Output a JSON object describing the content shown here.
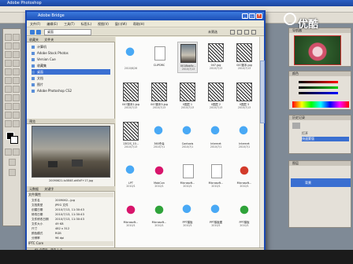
{
  "photoshop": {
    "title": "Adobe Photoshop",
    "menu": [],
    "watermark": "优酷"
  },
  "bridge": {
    "title": "Adobe Bridge",
    "menu": [
      "文件(F)",
      "编辑(E)",
      "工具(T)",
      "标签(L)",
      "视图(V)",
      "窗口(W)",
      "帮助(H)"
    ],
    "path_label": "桌面",
    "view_label": "未筛选",
    "left_tabs": [
      "收藏夹",
      "文件夹"
    ],
    "favorites": [
      "计算机",
      "Adobe Stock Photos",
      "Version Cue",
      "收藏集",
      "桌面",
      "文档",
      "图片",
      "Adobe Photoshop CS2"
    ],
    "preview_tab": "预览",
    "preview_caption": "20090621-tu584E-ahEdF+17.jpg",
    "metadata_tabs": [
      "元数据",
      "关键字"
    ],
    "metadata_section": "文件属性",
    "metadata": [
      {
        "k": "文件名",
        "v": "2009062...jpg"
      },
      {
        "k": "文档类型",
        "v": "JPEG 文件"
      },
      {
        "k": "创建日期",
        "v": "2010/7/13, 11:30:43"
      },
      {
        "k": "修改日期",
        "v": "2010/7/13, 11:30:43"
      },
      {
        "k": "文件修改日期",
        "v": "2010/7/13, 11:30:43"
      },
      {
        "k": "文件大小",
        "v": "49 KB"
      },
      {
        "k": "尺寸",
        "v": "482 x 312"
      },
      {
        "k": "颜色模式",
        "v": "RGB"
      },
      {
        "k": "分辨率",
        "v": "96 dpi"
      },
      {
        "k": "位深度",
        "v": "8"
      }
    ],
    "iptc_section": "IPTC Core",
    "status": "65 个项目，选中 1 个",
    "thumbnails": [
      {
        "label": "",
        "date": "2010/6/26",
        "kind": "ie"
      },
      {
        "label": "CLIPDRC",
        "date": "",
        "kind": "doc"
      },
      {
        "label": "0018bb5c...",
        "date": "2010/7/13",
        "kind": "photo"
      },
      {
        "label": "047.jpg",
        "date": "2010/7/13",
        "kind": "sketch"
      },
      {
        "label": "047副本.jpg",
        "date": "2010/7/13",
        "kind": "sketch"
      },
      {
        "label": "047副本2.jpg",
        "date": "2010/7/13",
        "kind": "sketch"
      },
      {
        "label": "047副本3.jpg",
        "date": "2010/7/13",
        "kind": "sketch"
      },
      {
        "label": "0图层 1",
        "date": "2010/7/13",
        "kind": "sketch"
      },
      {
        "label": "0图层 2",
        "date": "2010/7/13",
        "kind": "sketch"
      },
      {
        "label": "0图层 3",
        "date": "2010/7/13",
        "kind": "sketch"
      },
      {
        "label": "1302S_10...",
        "date": "2010/7/13",
        "kind": "sketch"
      },
      {
        "label": "360杀毒",
        "date": "2010/7/1",
        "kind": "ie"
      },
      {
        "label": "Contoxis",
        "date": "2010/7/1",
        "kind": "ie"
      },
      {
        "label": "Internet",
        "date": "2010/7/1",
        "kind": "ie"
      },
      {
        "label": "Internet",
        "date": "2010/7/1",
        "kind": "ie"
      },
      {
        "label": "LPT",
        "date": "2010/1",
        "kind": "ie"
      },
      {
        "label": "MobCon",
        "date": "2010/1",
        "kind": "magenta"
      },
      {
        "label": "Microsoft...",
        "date": "2010/1",
        "kind": "doc"
      },
      {
        "label": "Microsoft...",
        "date": "2010/1",
        "kind": "doc"
      },
      {
        "label": "Microsoft...",
        "date": "2010/1",
        "kind": "red"
      },
      {
        "label": "Microsoft...",
        "date": "2010/1",
        "kind": "magenta"
      },
      {
        "label": "Microsoft...",
        "date": "2010/1",
        "kind": "green"
      },
      {
        "label": "PPT模板",
        "date": "2010/1",
        "kind": "ie"
      },
      {
        "label": "PPT模板图",
        "date": "2010/1",
        "kind": "ie"
      },
      {
        "label": "PPT模板",
        "date": "2010/1",
        "kind": "green"
      }
    ]
  },
  "panels": {
    "navigator_tab": "导航器",
    "color_tab": "颜色",
    "history_tab": "历史记录",
    "history_items": [
      "打开",
      "快速蒙版"
    ],
    "layers_tab": "图层",
    "layer_name": "背景"
  }
}
